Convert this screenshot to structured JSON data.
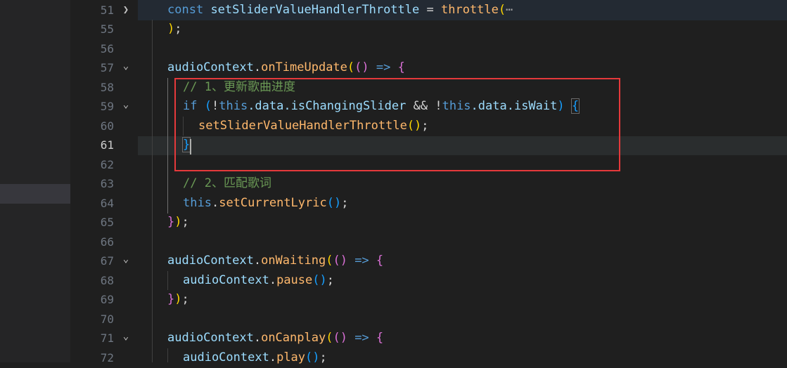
{
  "sidebar": {
    "highlight": "selected explorer row"
  },
  "gutter": {
    "line_numbers": [
      "51",
      "55",
      "56",
      "57",
      "58",
      "59",
      "60",
      "61",
      "62",
      "63",
      "64",
      "65",
      "66",
      "67",
      "68",
      "69",
      "70",
      "71",
      "72"
    ],
    "active_line": "61"
  },
  "code": {
    "l51_a": "const",
    "l51_b": "setSliderValueHandlerThrottle",
    "l51_c": "=",
    "l51_d": "throttle",
    "l51_e": "(",
    "l51_f": "⋯",
    "l55_a": ")",
    "l55_b": ";",
    "l57_a": "audioContext",
    "l57_b": ".",
    "l57_c": "onTimeUpdate",
    "l57_d": "(",
    "l57_e": "()",
    "l57_f": "=>",
    "l57_g": "{",
    "l58_a": "// 1、更新歌曲进度",
    "l59_a": "if",
    "l59_b": "(",
    "l59_c": "!",
    "l59_d": "this",
    "l59_e": ".data.isChangingSlider",
    "l59_f": "&&",
    "l59_g": "!",
    "l59_h": "this",
    "l59_i": ".data.isWait",
    "l59_j": ")",
    "l59_k": "{",
    "l60_a": "setSliderValueHandlerThrottle",
    "l60_b": "()",
    "l60_c": ";",
    "l61_a": "}",
    "l63_a": "// 2、匹配歌词",
    "l64_a": "this",
    "l64_b": ".",
    "l64_c": "setCurrentLyric",
    "l64_d": "()",
    "l64_e": ";",
    "l65_a": "}",
    "l65_b": ")",
    "l65_c": ";",
    "l67_a": "audioContext",
    "l67_b": ".",
    "l67_c": "onWaiting",
    "l67_d": "(",
    "l67_e": "()",
    "l67_f": "=>",
    "l67_g": "{",
    "l68_a": "audioContext",
    "l68_b": ".",
    "l68_c": "pause",
    "l68_d": "()",
    "l68_e": ";",
    "l69_a": "}",
    "l69_b": ")",
    "l69_c": ";",
    "l71_a": "audioContext",
    "l71_b": ".",
    "l71_c": "onCanplay",
    "l71_d": "(",
    "l71_e": "()",
    "l71_f": "=>",
    "l71_g": "{",
    "l72_a": "audioContext",
    "l72_b": ".",
    "l72_c": "play",
    "l72_d": "()",
    "l72_e": ";"
  },
  "colors": {
    "annotation_box": "#e5393b",
    "background": "#1f1f1f"
  }
}
